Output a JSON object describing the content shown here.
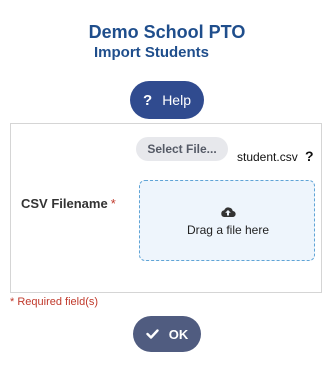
{
  "header": {
    "org_title": "Demo School PTO",
    "page_subtitle": "Import Students"
  },
  "help_button": {
    "icon": "question-mark-icon",
    "icon_glyph": "?",
    "label": "Help"
  },
  "form": {
    "select_file_label": "Select File...",
    "selected_filename": "student.csv",
    "file_help_glyph": "?",
    "field_label": "CSV Filename",
    "required_marker": "*",
    "dropzone": {
      "icon": "cloud-upload-icon",
      "text": "Drag a file here"
    }
  },
  "footer": {
    "required_note": "* Required field(s)",
    "ok_label": "OK",
    "ok_icon": "checkmark-icon"
  },
  "colors": {
    "title": "#1f4e8c",
    "help_button": "#304b8f",
    "ok_button": "#505c80",
    "required": "#c0392b",
    "dropzone_border": "#5fa4d6",
    "dropzone_bg": "#eef5fc"
  }
}
